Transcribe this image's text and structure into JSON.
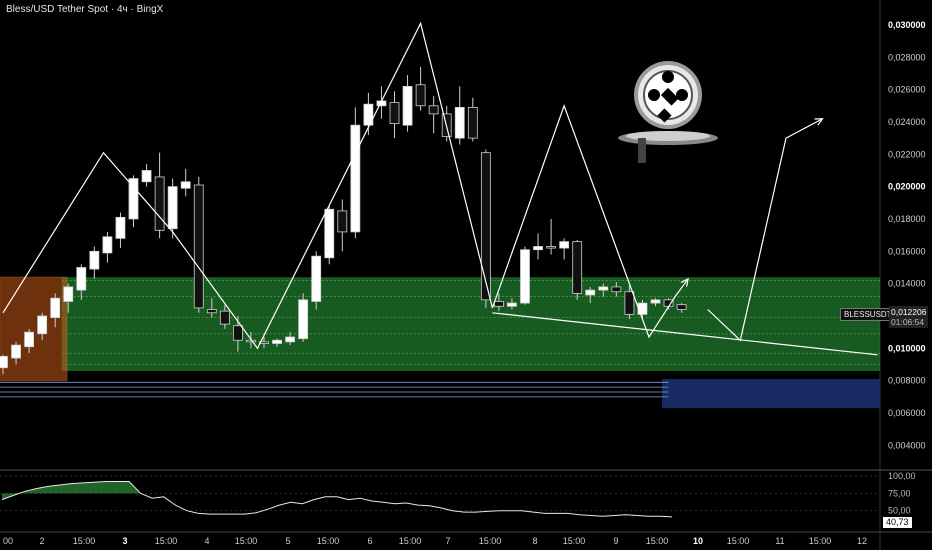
{
  "header": {
    "title": "Bless/USD Tether Spot · 4ч · BingX"
  },
  "price_tag": {
    "symbol": "BLESSUSDT",
    "price": "0,012206",
    "countdown": "01:06:54"
  },
  "oscillator_tag": {
    "value": "40,73"
  },
  "colors": {
    "bull": "#ffffff",
    "bear": "#111111",
    "green_zone": "#1f7a2b",
    "orange_zone": "#c85a1a",
    "blue_zone": "#1a2f6e",
    "line": "#ffffff"
  },
  "icon": "logo-coin-icon",
  "chart_data": [
    {
      "type": "candlestick",
      "title": "",
      "y_ticks": [
        "0,030000",
        "0,028000",
        "0,026000",
        "0,024000",
        "0,022000",
        "0,020000",
        "0,018000",
        "0,016000",
        "0,014000",
        "0,012000",
        "0,010000",
        "0,008000",
        "0,006000",
        "0,004000"
      ],
      "y_bold": [
        "0,030000",
        "0,020000",
        "0,010000"
      ],
      "ylim": [
        0.0026,
        0.0308
      ],
      "x_ticks": [
        "00",
        "2",
        "15:00",
        "3",
        "15:00",
        "4",
        "15:00",
        "5",
        "15:00",
        "6",
        "15:00",
        "7",
        "15:00",
        "8",
        "15:00",
        "9",
        "15:00",
        "10",
        "15:00",
        "11",
        "15:00",
        "12"
      ],
      "x_bold": [
        "3",
        "10"
      ],
      "candles": [
        {
          "o": 0.0088,
          "h": 0.0096,
          "l": 0.0084,
          "c": 0.0095
        },
        {
          "o": 0.0094,
          "h": 0.0104,
          "l": 0.009,
          "c": 0.0102
        },
        {
          "o": 0.0101,
          "h": 0.0112,
          "l": 0.0097,
          "c": 0.011
        },
        {
          "o": 0.0109,
          "h": 0.0122,
          "l": 0.0105,
          "c": 0.012
        },
        {
          "o": 0.0119,
          "h": 0.0134,
          "l": 0.0113,
          "c": 0.0131
        },
        {
          "o": 0.0129,
          "h": 0.014,
          "l": 0.0122,
          "c": 0.0138
        },
        {
          "o": 0.0136,
          "h": 0.0152,
          "l": 0.013,
          "c": 0.015
        },
        {
          "o": 0.0149,
          "h": 0.0163,
          "l": 0.0143,
          "c": 0.016
        },
        {
          "o": 0.0159,
          "h": 0.0172,
          "l": 0.0153,
          "c": 0.0169
        },
        {
          "o": 0.0168,
          "h": 0.0184,
          "l": 0.0162,
          "c": 0.0181
        },
        {
          "o": 0.018,
          "h": 0.0207,
          "l": 0.0175,
          "c": 0.0205
        },
        {
          "o": 0.0203,
          "h": 0.0214,
          "l": 0.02,
          "c": 0.021
        },
        {
          "o": 0.0206,
          "h": 0.0221,
          "l": 0.0168,
          "c": 0.0173
        },
        {
          "o": 0.0174,
          "h": 0.0205,
          "l": 0.0168,
          "c": 0.02
        },
        {
          "o": 0.0199,
          "h": 0.0211,
          "l": 0.0194,
          "c": 0.0203
        },
        {
          "o": 0.0201,
          "h": 0.0206,
          "l": 0.0122,
          "c": 0.0125
        },
        {
          "o": 0.0124,
          "h": 0.0131,
          "l": 0.0119,
          "c": 0.0122
        },
        {
          "o": 0.0123,
          "h": 0.0127,
          "l": 0.0112,
          "c": 0.0115
        },
        {
          "o": 0.0114,
          "h": 0.012,
          "l": 0.0098,
          "c": 0.0105
        },
        {
          "o": 0.0105,
          "h": 0.011,
          "l": 0.01,
          "c": 0.0104
        },
        {
          "o": 0.0104,
          "h": 0.0107,
          "l": 0.01,
          "c": 0.0103
        },
        {
          "o": 0.0103,
          "h": 0.0106,
          "l": 0.0101,
          "c": 0.0105
        },
        {
          "o": 0.0104,
          "h": 0.011,
          "l": 0.0102,
          "c": 0.0107
        },
        {
          "o": 0.0106,
          "h": 0.0134,
          "l": 0.0104,
          "c": 0.013
        },
        {
          "o": 0.0129,
          "h": 0.016,
          "l": 0.0124,
          "c": 0.0157
        },
        {
          "o": 0.0156,
          "h": 0.0188,
          "l": 0.0152,
          "c": 0.0186
        },
        {
          "o": 0.0185,
          "h": 0.0192,
          "l": 0.016,
          "c": 0.0172
        },
        {
          "o": 0.0172,
          "h": 0.0249,
          "l": 0.0168,
          "c": 0.0238
        },
        {
          "o": 0.0238,
          "h": 0.0258,
          "l": 0.0232,
          "c": 0.0251
        },
        {
          "o": 0.025,
          "h": 0.0262,
          "l": 0.0242,
          "c": 0.0253
        },
        {
          "o": 0.0252,
          "h": 0.0259,
          "l": 0.023,
          "c": 0.0239
        },
        {
          "o": 0.0238,
          "h": 0.0269,
          "l": 0.0234,
          "c": 0.0262
        },
        {
          "o": 0.0263,
          "h": 0.0274,
          "l": 0.0247,
          "c": 0.025
        },
        {
          "o": 0.025,
          "h": 0.0256,
          "l": 0.0233,
          "c": 0.0245
        },
        {
          "o": 0.0245,
          "h": 0.025,
          "l": 0.0228,
          "c": 0.0231
        },
        {
          "o": 0.023,
          "h": 0.0262,
          "l": 0.0226,
          "c": 0.0249
        },
        {
          "o": 0.0249,
          "h": 0.0255,
          "l": 0.0228,
          "c": 0.023
        },
        {
          "o": 0.0221,
          "h": 0.0223,
          "l": 0.0125,
          "c": 0.013
        },
        {
          "o": 0.0129,
          "h": 0.0134,
          "l": 0.0123,
          "c": 0.0126
        },
        {
          "o": 0.0126,
          "h": 0.0131,
          "l": 0.0124,
          "c": 0.0128
        },
        {
          "o": 0.0128,
          "h": 0.0163,
          "l": 0.0127,
          "c": 0.0161
        },
        {
          "o": 0.0161,
          "h": 0.0171,
          "l": 0.0155,
          "c": 0.0163
        },
        {
          "o": 0.0163,
          "h": 0.018,
          "l": 0.0158,
          "c": 0.0162
        },
        {
          "o": 0.0162,
          "h": 0.0168,
          "l": 0.0155,
          "c": 0.0166
        },
        {
          "o": 0.0166,
          "h": 0.0167,
          "l": 0.013,
          "c": 0.0134
        },
        {
          "o": 0.0133,
          "h": 0.0138,
          "l": 0.0128,
          "c": 0.0136
        },
        {
          "o": 0.0136,
          "h": 0.014,
          "l": 0.0132,
          "c": 0.0138
        },
        {
          "o": 0.0138,
          "h": 0.0141,
          "l": 0.0132,
          "c": 0.0135
        },
        {
          "o": 0.0135,
          "h": 0.0139,
          "l": 0.0118,
          "c": 0.0121
        },
        {
          "o": 0.0121,
          "h": 0.013,
          "l": 0.0118,
          "c": 0.0128
        },
        {
          "o": 0.0128,
          "h": 0.0131,
          "l": 0.0126,
          "c": 0.013
        },
        {
          "o": 0.013,
          "h": 0.0131,
          "l": 0.0124,
          "c": 0.0126
        },
        {
          "o": 0.0127,
          "h": 0.0128,
          "l": 0.0122,
          "c": 0.0124
        }
      ],
      "zones": [
        {
          "name": "green-zone",
          "y1": 0.0086,
          "y2": 0.0144
        },
        {
          "name": "orange-zone",
          "y1": 0.008,
          "y2": 0.0144
        },
        {
          "name": "blue-zone",
          "y1": 0.0063,
          "y2": 0.0081
        }
      ],
      "pattern_lines": [
        [
          [
            0,
            0.0122
          ],
          [
            7.7,
            0.0221
          ],
          [
            13,
            0.0172
          ],
          [
            19.5,
            0.01
          ],
          [
            32,
            0.0301
          ],
          [
            37.5,
            0.0125
          ]
        ],
        [
          [
            37.5,
            0.0125
          ],
          [
            43,
            0.025
          ],
          [
            49.5,
            0.0107
          ],
          [
            51.5,
            0.0132
          ]
        ],
        [
          [
            54,
            0.0124
          ],
          [
            56.5,
            0.0105
          ],
          [
            60,
            0.023
          ]
        ],
        [
          [
            37.5,
            0.0122
          ],
          [
            67,
            0.0096
          ]
        ]
      ]
    },
    {
      "type": "line",
      "title": "",
      "y_ticks": [
        "100,00",
        "75,00",
        "50,00"
      ],
      "ylim": [
        25,
        100
      ],
      "values": [
        66,
        72,
        78,
        82,
        85,
        87,
        89,
        90,
        91,
        92,
        92,
        92,
        75,
        68,
        70,
        58,
        50,
        46,
        45,
        45,
        45,
        45,
        47,
        52,
        58,
        62,
        60,
        66,
        70,
        70,
        66,
        68,
        64,
        62,
        60,
        61,
        58,
        57,
        54,
        50,
        48,
        48,
        49,
        50,
        50,
        50,
        48,
        46,
        46,
        46,
        44,
        43,
        42,
        43,
        44,
        43,
        42,
        42,
        41
      ]
    }
  ]
}
